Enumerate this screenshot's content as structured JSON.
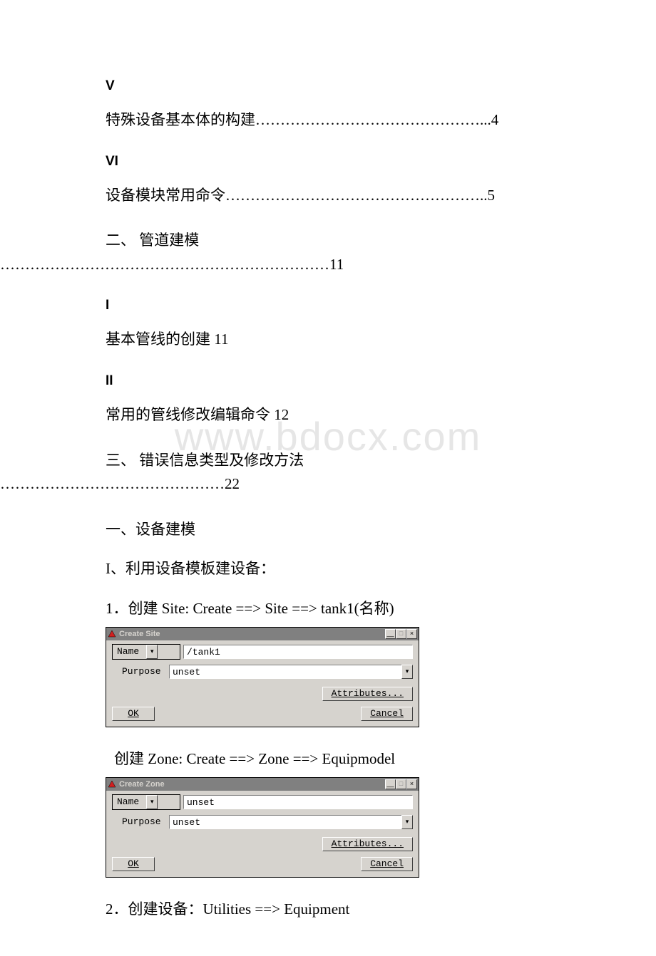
{
  "watermark": "www.bdocx.com",
  "toc": {
    "v_marker": "V",
    "v_text": " 特殊设备基本体的构建………………………………………...4",
    "vi_marker": "VI",
    "vi_text": " 设备模块常用命令……………………………………………..5",
    "sec2_first": "二、 管道建模",
    "sec2_second": "…………………………………………………………11",
    "i_marker": "I",
    "i_text": "基本管线的创建 11",
    "ii_marker": "II",
    "ii_text": "常用的管线修改编辑命令 12",
    "sec3_first": "三、 错误信息类型及修改方法",
    "sec3_second": "………………………………………22"
  },
  "body": {
    "h1": "一、设备建模",
    "h2": "I、利用设备模板建设备：",
    "step1": "1．创建 Site: Create ==> Site ==> tank1(名称)",
    "zone_text": " 创建 Zone: Create ==> Zone ==> Equipmodel",
    "step2": "2．创建设备：Utilities ==> Equipment"
  },
  "dialog_site": {
    "title": "Create Site",
    "name_label": "Name",
    "name_value": "/tank1",
    "purpose_label": "Purpose",
    "purpose_value": "unset",
    "attributes_btn": "Attributes...",
    "ok_btn": "OK",
    "cancel_btn": "Cancel",
    "min_glyph": "__",
    "max_glyph": "□",
    "close_glyph": "×"
  },
  "dialog_zone": {
    "title": "Create Zone",
    "name_label": "Name",
    "name_value": "unset",
    "purpose_label": "Purpose",
    "purpose_value": "unset",
    "attributes_btn": "Attributes...",
    "ok_btn": "OK",
    "cancel_btn": "Cancel",
    "min_glyph": "__",
    "max_glyph": "□",
    "close_glyph": "×"
  }
}
